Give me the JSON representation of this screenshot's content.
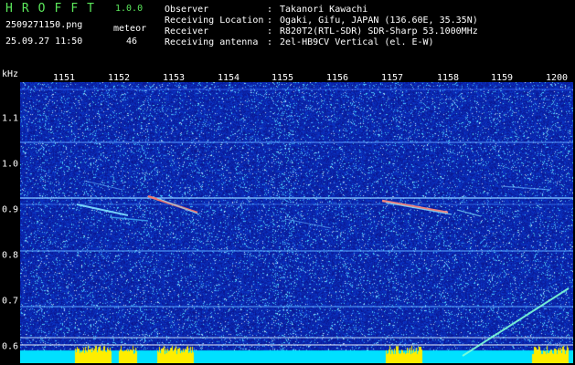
{
  "header": {
    "app_title_letters": [
      "H",
      "R",
      "O",
      "F",
      "F",
      "T"
    ],
    "version": "1.0.0",
    "filename": "2509271150.png",
    "timestamp": "25.09.27 11:50",
    "meteor_label": "meteor",
    "meteor_count": "46"
  },
  "meta": [
    {
      "label": "Observer",
      "value": "Takanori Kawachi"
    },
    {
      "label": "Receiving Location",
      "value": "Ogaki, Gifu, JAPAN (136.60E, 35.35N)"
    },
    {
      "label": "Receiver",
      "value": "R820T2(RTL-SDR) SDR-Sharp 53.1000MHz"
    },
    {
      "label": "Receiving antenna",
      "value": "2el-HB9CV Vertical (el. E-W)"
    }
  ],
  "freq_axis": {
    "unit": "kHz",
    "ticks": [
      "1151",
      "1152",
      "1153",
      "1154",
      "1155",
      "1156",
      "1157",
      "1158",
      "1159",
      "1200"
    ]
  },
  "y_axis": {
    "ticks": [
      "1.1",
      "1.0",
      "0.9",
      "0.8",
      "0.7",
      "0.6"
    ]
  },
  "colors": {
    "background": "#000000",
    "spectrogram_base": "#0a1a9a",
    "title_green": "#5be85b",
    "baseline_cyan": "#00e0ff",
    "baseline_yellow": "#ffee00"
  }
}
